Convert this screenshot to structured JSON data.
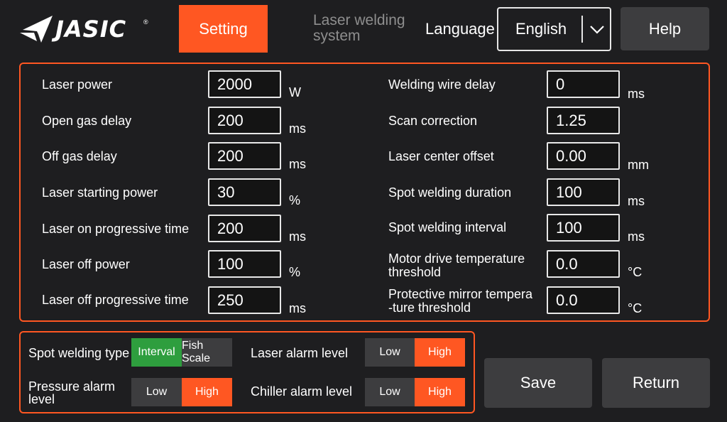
{
  "header": {
    "brand": "JASIC",
    "setting_label": "Setting",
    "app_title": "Laser welding system",
    "language_label": "Language",
    "language_value": "English",
    "help_label": "Help"
  },
  "params_left": [
    {
      "label": "Laser power",
      "value": "2000",
      "unit": "W"
    },
    {
      "label": "Open gas delay",
      "value": "200",
      "unit": "ms"
    },
    {
      "label": "Off gas delay",
      "value": "200",
      "unit": "ms"
    },
    {
      "label": "Laser starting power",
      "value": "30",
      "unit": "%"
    },
    {
      "label": "Laser on progressive time",
      "value": "200",
      "unit": "ms"
    },
    {
      "label": "Laser off power",
      "value": "100",
      "unit": "%"
    },
    {
      "label": "Laser off progressive time",
      "value": "250",
      "unit": "ms"
    }
  ],
  "params_right": [
    {
      "label": "Welding wire delay",
      "value": "0",
      "unit": "ms"
    },
    {
      "label": "Scan correction",
      "value": "1.25",
      "unit": ""
    },
    {
      "label": "Laser center offset",
      "value": "0.00",
      "unit": "mm"
    },
    {
      "label": "Spot welding duration",
      "value": "100",
      "unit": "ms"
    },
    {
      "label": "Spot welding interval",
      "value": "100",
      "unit": "ms"
    },
    {
      "label": "Motor drive temperature threshold",
      "value": "0.0",
      "unit": "°C"
    },
    {
      "label": "Protective mirror tempera-ture threshold",
      "value": "0.0",
      "unit": "°C"
    }
  ],
  "alarm": {
    "spot_type": {
      "label": "Spot welding type",
      "options": [
        "Interval",
        "Fish Scale"
      ],
      "selected": "Interval"
    },
    "pressure": {
      "label": "Pressure alarm level",
      "options": [
        "Low",
        "High"
      ],
      "selected": "High"
    },
    "laser": {
      "label": "Laser alarm level",
      "options": [
        "Low",
        "High"
      ],
      "selected": "High"
    },
    "chiller": {
      "label": "Chiller alarm level",
      "options": [
        "Low",
        "High"
      ],
      "selected": "High"
    }
  },
  "actions": {
    "save_label": "Save",
    "return_label": "Return"
  },
  "icons": {
    "logo": "jasic-logo-icon",
    "dropdown": "chevron-down-icon"
  },
  "colors": {
    "accent": "#ff5722",
    "selected_green": "#2e9e3e",
    "button_bg": "#3d3d3f",
    "background": "#1e1e20"
  }
}
